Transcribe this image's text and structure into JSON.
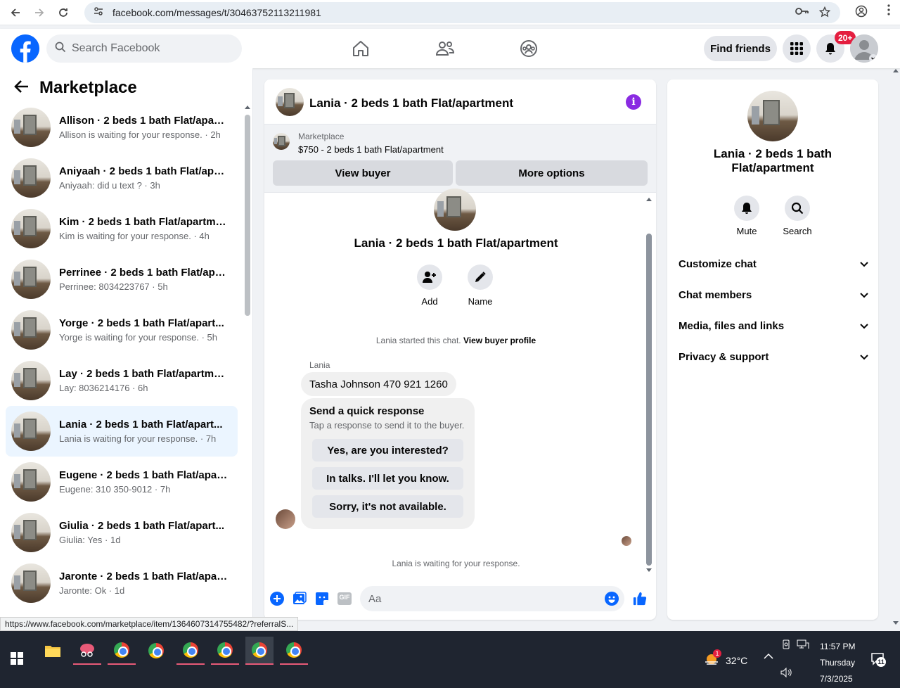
{
  "browser": {
    "url": "facebook.com/messages/t/30463752113211981",
    "status_link": "https://www.facebook.com/marketplace/item/1364607314755482/?referralS..."
  },
  "header": {
    "search_placeholder": "Search Facebook",
    "find_friends": "Find friends",
    "notif_badge": "20+",
    "brand_color": "#0866ff"
  },
  "left": {
    "title": "Marketplace",
    "conversations": [
      {
        "name": "Allison · 2 beds 1 bath Flat/apart...",
        "sub": "Allison is waiting for your response. · 2h"
      },
      {
        "name": "Aniyaah · 2 beds 1 bath Flat/apa...",
        "sub": "Aniyaah: did u text ? · 3h"
      },
      {
        "name": "Kim · 2 beds 1 bath Flat/apartme...",
        "sub": "Kim is waiting for your response. · 4h"
      },
      {
        "name": "Perrinee · 2 beds 1 bath Flat/apa...",
        "sub": "Perrinee: 8034223767 · 5h"
      },
      {
        "name": "Yorge · 2 beds 1 bath Flat/apart...",
        "sub": "Yorge is waiting for your response. · 5h"
      },
      {
        "name": "Lay · 2 beds 1 bath Flat/apartment",
        "sub": "Lay: 8036214176 · 6h"
      },
      {
        "name": "Lania · 2 beds 1 bath Flat/apart...",
        "sub": "Lania is waiting for your response. · 7h"
      },
      {
        "name": "Eugene · 2 beds 1 bath Flat/apar...",
        "sub": "Eugene: 310 350-9012 · 7h"
      },
      {
        "name": "Giulia · 2 beds 1 bath Flat/apart...",
        "sub": "Giulia: Yes · 1d"
      },
      {
        "name": "Jaronte · 2 beds 1 bath Flat/apar...",
        "sub": "Jaronte: Ok · 1d"
      }
    ]
  },
  "chat": {
    "title": "Lania · 2 beds 1 bath Flat/apartment",
    "marketplace_label": "Marketplace",
    "listing": "$750 - 2 beds 1 bath Flat/apartment",
    "view_buyer": "View buyer",
    "more_options": "More options",
    "thread_title": "Lania · 2 beds 1 bath Flat/apartment",
    "add_label": "Add",
    "name_label": "Name",
    "started_text": "Lania started this chat.",
    "view_profile": "View buyer profile",
    "sender": "Lania",
    "message": "Tasha Johnson 470 921 1260",
    "quick_title": "Send a quick response",
    "quick_sub": "Tap a response to send it to the buyer.",
    "quick_options": [
      "Yes, are you interested?",
      "In talks. I'll let you know.",
      "Sorry, it's not available."
    ],
    "waiting": "Lania is waiting for your response.",
    "input_placeholder": "Aa",
    "gif_label": "GIF"
  },
  "right": {
    "title": "Lania · 2 beds 1 bath Flat/apartment",
    "mute": "Mute",
    "search": "Search",
    "sections": [
      "Customize chat",
      "Chat members",
      "Media, files and links",
      "Privacy & support"
    ]
  },
  "taskbar": {
    "temperature": "32°C",
    "time": "11:57 PM",
    "day": "Thursday",
    "date": "7/3/2025",
    "weather_badge": "1",
    "notif_count": "11"
  }
}
